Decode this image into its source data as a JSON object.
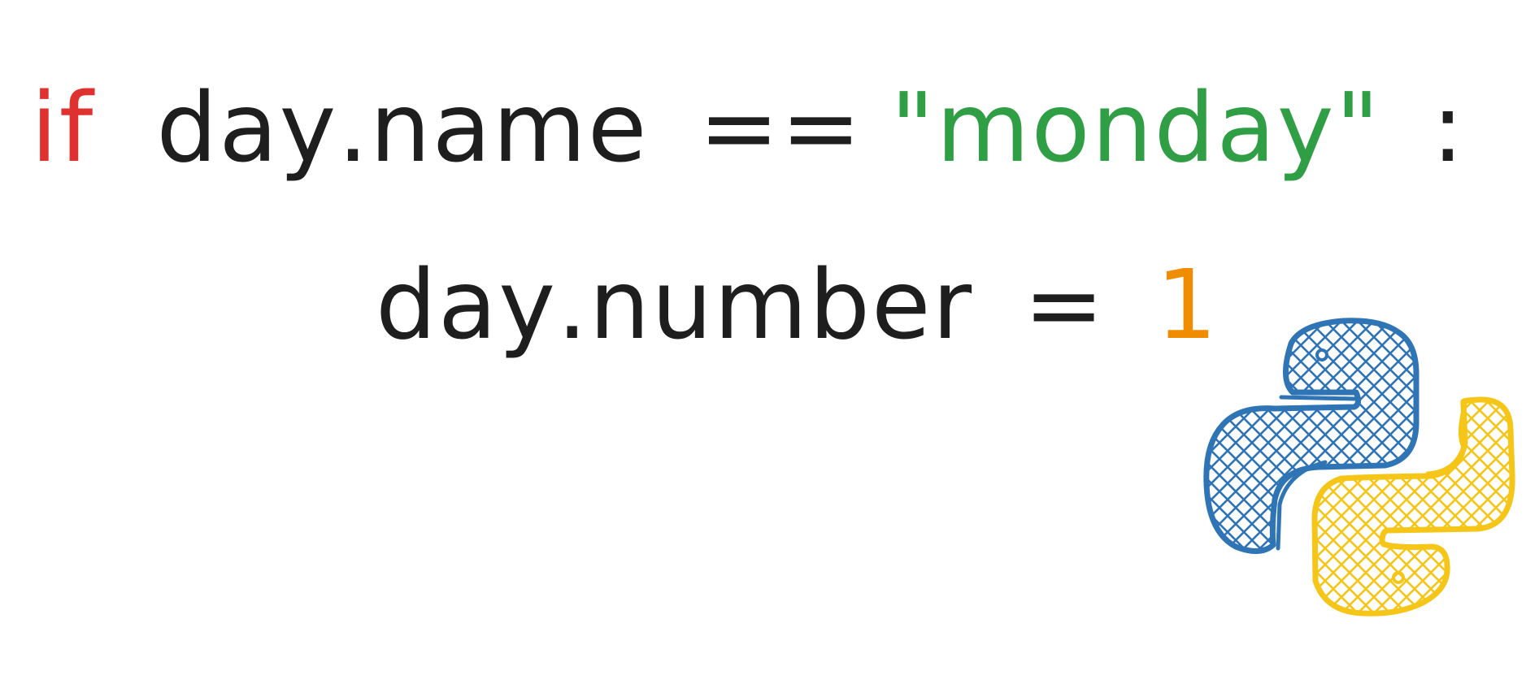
{
  "code": {
    "line1": {
      "keyword": "if",
      "object": "day",
      "dot": ".",
      "attribute": "name",
      "operator": "==",
      "string_literal": "\"monday\"",
      "colon": ":"
    },
    "line2": {
      "object": "day",
      "dot": ".",
      "attribute": "number",
      "operator": "=",
      "number_literal": "1"
    }
  },
  "colors": {
    "keyword": "#e03131",
    "text": "#1e1e1e",
    "string": "#2f9e44",
    "number": "#f08c00",
    "logo_blue": "#2f74b5",
    "logo_yellow": "#f5c518"
  },
  "icons": {
    "logo": "python-logo-icon"
  }
}
